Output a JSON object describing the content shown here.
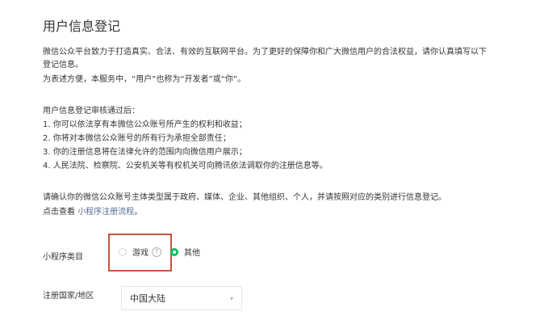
{
  "page": {
    "title": "用户信息登记"
  },
  "intro": {
    "line1": "微信公众平台致力于打造真实、合法、有效的互联网平台。为了更好的保障你和广大微信用户的合法权益，请你认真填写以下",
    "line2": "登记信息。",
    "line3": "为表述方便，本服务中，“用户”也称为“开发者”或“你”。"
  },
  "after_review": {
    "heading": "用户信息登记审核通过后：",
    "items": [
      "1. 你可以依法享有本微信公众账号所产生的权利和收益；",
      "2. 你将对本微信公众账号的所有行为承担全部责任；",
      "3. 你的注册信息将在法律允许的范围内向微信用户展示；",
      "4. 人民法院、检察院、公安机关等有权机关可向腾讯依法调取你的注册信息等。"
    ]
  },
  "confirm": {
    "line1": "请确认你的微信公众账号主体类型属于政府、媒体、企业、其他组织、个人，并请按照对应的类别进行信息登记。",
    "line2_prefix": "点击查看 ",
    "line2_link": "小程序注册流程",
    "line2_suffix": "。"
  },
  "form": {
    "category_label": "小程序类目",
    "category_options": [
      {
        "label": "游戏",
        "selected": false,
        "help": "?"
      },
      {
        "label": "其他",
        "selected": true
      }
    ],
    "country_label": "注册国家/地区",
    "country_value": "中国大陆",
    "caret": "▾"
  },
  "colors": {
    "accent_green": "#07c160",
    "link_blue": "#576b95",
    "highlight_red": "#c0573b"
  }
}
